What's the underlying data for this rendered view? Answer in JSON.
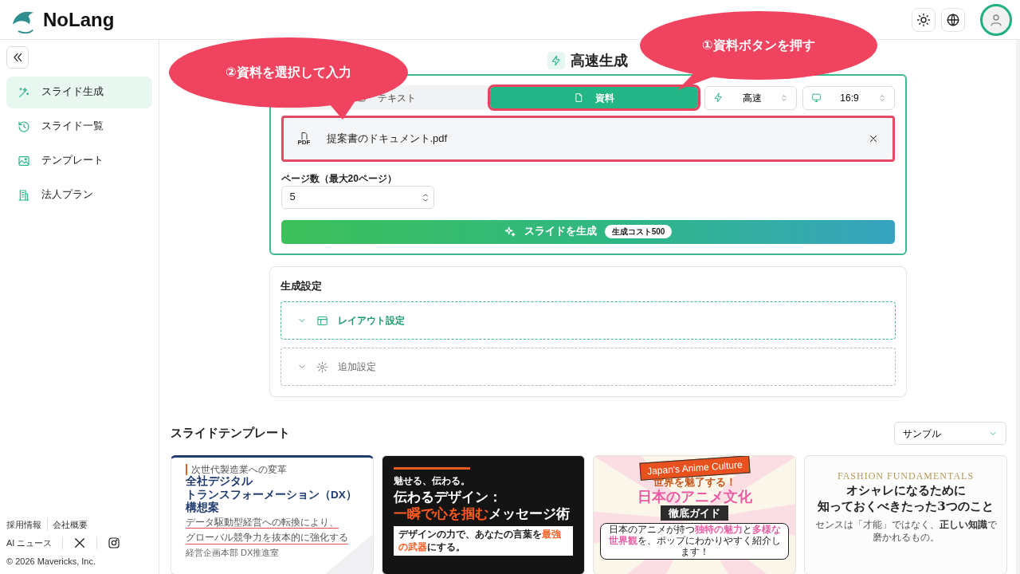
{
  "header": {
    "logo_text": "NoLang"
  },
  "sidebar": {
    "items": [
      {
        "label": "スライド生成",
        "kind": "wand",
        "selected": true
      },
      {
        "label": "スライド一覧",
        "kind": "history",
        "selected": false
      },
      {
        "label": "テンプレート",
        "kind": "image",
        "selected": false
      },
      {
        "label": "法人プラン",
        "kind": "building",
        "selected": false
      }
    ],
    "footer_links": [
      "採用情報",
      "会社概要"
    ],
    "news_link": "AI ニュース",
    "copyright": "© 2026 Mavericks, Inc."
  },
  "generator": {
    "title": "高速生成",
    "source_tabs": [
      {
        "label": "テキスト",
        "kind": "text",
        "selected": false,
        "highlighted": false
      },
      {
        "label": "資料",
        "kind": "pdf",
        "selected": true,
        "highlighted": true
      }
    ],
    "selects": [
      {
        "kind": "speed",
        "value": "高速"
      },
      {
        "kind": "ratio",
        "value": "16:9"
      }
    ],
    "file": {
      "name": "提案書のドキュメント.pdf",
      "icon_label": "PDF",
      "highlighted": true
    },
    "page_count": {
      "label": "ページ数（最大20ページ）",
      "value": "5"
    },
    "generate_button": {
      "label": "スライドを生成",
      "cost_badge": "生成コスト500"
    }
  },
  "settings": {
    "title": "生成設定",
    "sections": [
      {
        "label": "レイアウト設定",
        "kind": "layout",
        "expanded": false,
        "active": true
      },
      {
        "label": "追加設定",
        "kind": "gear",
        "expanded": false,
        "active": false
      }
    ]
  },
  "templates": {
    "title": "スライドテンプレート",
    "filter": "サンプル",
    "cards": [
      {
        "kind": "dx",
        "kicker": "次世代製造業への変革",
        "title_lines": [
          "全社デジタル",
          "トランスフォーメーション（DX）",
          "構想案"
        ],
        "desc_lines": [
          "データ駆動型経営への転換により、",
          "グローバル競争力を抜本的に強化する"
        ],
        "meta": "経営企画本部 DX推進室"
      },
      {
        "kind": "dark",
        "kicker": "魅せる、伝わる。",
        "title_lines": [
          "伝わるデザイン：",
          "**一瞬で心を掴む**メッセージ術"
        ],
        "desc_lines": [
          "デザインの力で、あなたの言葉を**最強の武器**にする。"
        ]
      },
      {
        "kind": "anime",
        "tag": "Japan's Anime Culture",
        "kicker": "世界を魅了する！",
        "title_lines": [
          "日本のアニメ文化"
        ],
        "box": "徹底ガイド",
        "desc_lines": [
          "日本のアニメが持つ**独特の魅力**と**多様な世界観**を、ポップにわかりやすく紹介します！"
        ]
      },
      {
        "kind": "fashion",
        "kicker": "FASHION FUNDAMENTALS",
        "title_lines": [
          "オシャレになるために",
          "知っておくべきたった3つのこと"
        ],
        "desc_lines": [
          "センスは「才能」ではなく、**正しい知識**で磨かれるもの。"
        ]
      }
    ]
  },
  "callouts": [
    {
      "text": "①資料ボタンを押す"
    },
    {
      "text": "②資料を選択して入力"
    }
  ]
}
